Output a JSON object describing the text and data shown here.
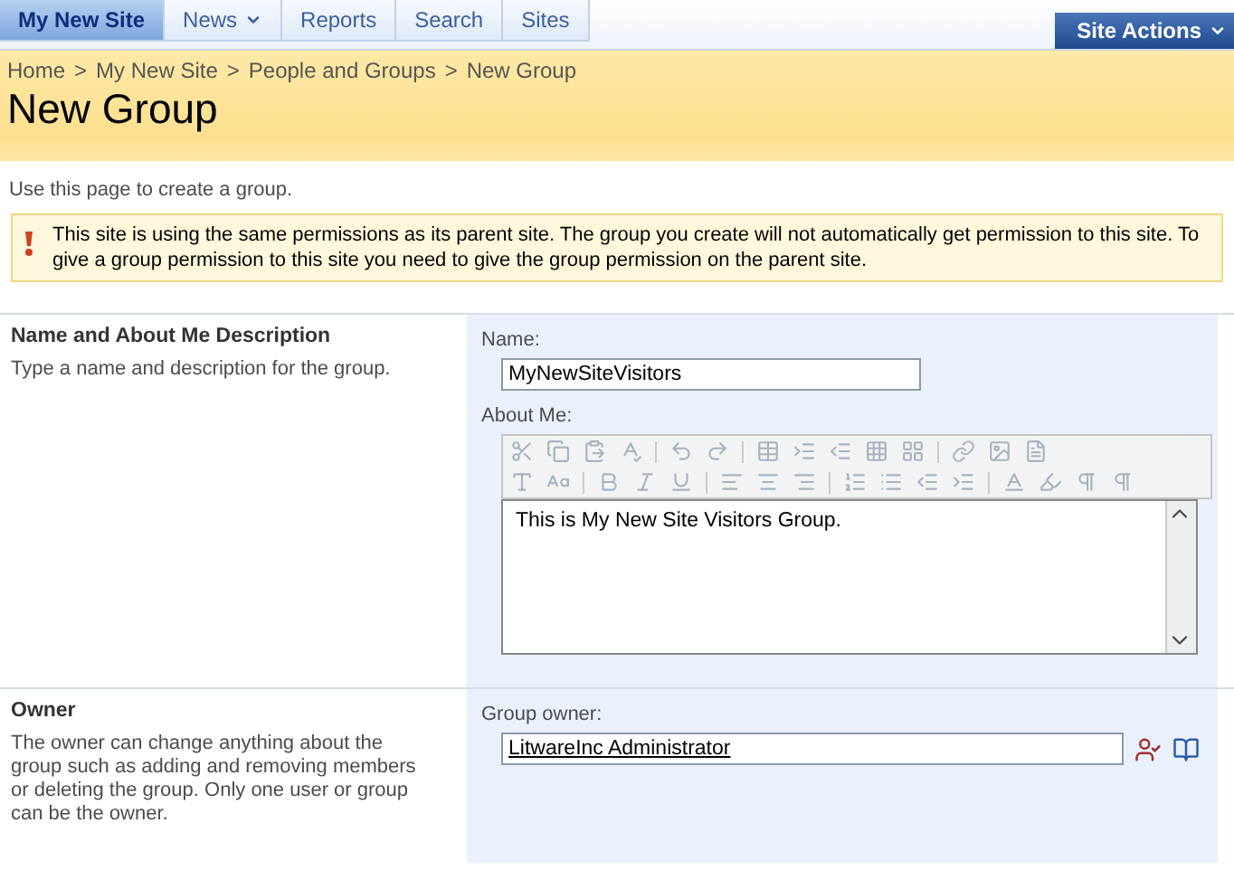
{
  "top_nav": {
    "tabs": [
      {
        "label": "My New Site",
        "selected": true,
        "menu": false
      },
      {
        "label": "News",
        "selected": false,
        "menu": true
      },
      {
        "label": "Reports",
        "selected": false,
        "menu": false
      },
      {
        "label": "Search",
        "selected": false,
        "menu": false
      },
      {
        "label": "Sites",
        "selected": false,
        "menu": false
      }
    ],
    "site_actions": "Site Actions"
  },
  "breadcrumb": [
    "Home",
    "My New Site",
    "People and Groups",
    "New Group"
  ],
  "breadcrumb_separator": ">",
  "page_title": "New Group",
  "intro": "Use this page to create a group.",
  "warning": "This site is using the same permissions as its parent site. The group you create will not automatically get permission to this site. To give a group permission to this site you need to give the group permission on the parent site.",
  "sections": [
    {
      "kind": "name",
      "title": "Name and About Me Description",
      "description": "Type a name and description for the group.",
      "name_label": "Name:",
      "name_value": "MyNewSiteVisitors",
      "about_label": "About Me:",
      "about_value": "This is My New Site Visitors Group.",
      "toolbar_disabled": true
    },
    {
      "kind": "owner",
      "title": "Owner",
      "description": "The owner can change anything about the group such as adding and removing members or deleting the group. Only one user or group can be the owner.",
      "owner_label": "Group owner:",
      "owner_value": "LitwareInc Administrator"
    }
  ]
}
